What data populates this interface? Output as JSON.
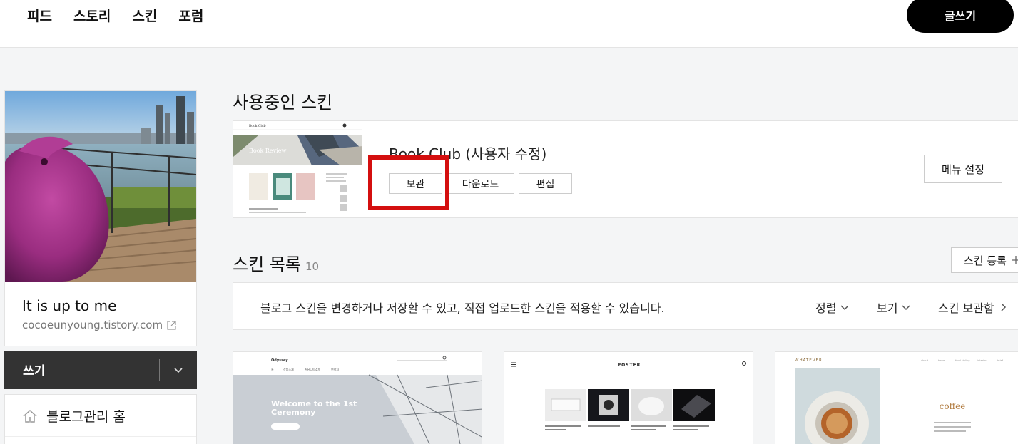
{
  "topnav": {
    "items": [
      "피드",
      "스토리",
      "스킨",
      "포럼"
    ],
    "write_label": "글쓰기"
  },
  "sidebar": {
    "blog_name": "It is up to me",
    "blog_url": "cocoeunyoung.tistory.com",
    "write_label": "쓰기",
    "admin_home_label": "블로그관리 홈"
  },
  "current_skin": {
    "section_title": "사용중인 스킨",
    "name": "Book Club (사용자 수정)",
    "buttons": [
      "보관",
      "다운로드",
      "편집"
    ],
    "menu_settings_label": "메뉴 설정",
    "thumb": {
      "brand": "Book Club",
      "banner": "Book Review"
    }
  },
  "skin_list": {
    "section_title": "스킨 목록",
    "count": "10",
    "register_label": "스킨 등록",
    "info_text": "블로그 스킨을 변경하거나 저장할 수 있고, 직접 업로드한 스킨을 적용할 수 있습니다.",
    "sort_label": "정렬",
    "view_label": "보기",
    "storage_label": "스킨 보관함",
    "cards": [
      {
        "brand": "Odyssey",
        "headline": "Welcome to the 1st Ceremony"
      },
      {
        "brand": "POSTER"
      },
      {
        "brand": "WHATEVER",
        "headline": "coffee"
      }
    ]
  },
  "colors": {
    "highlight": "#d40f0f",
    "write_button_bg": "#000000",
    "write_bar_bg": "#333333",
    "page_bg": "#f4f5f6"
  }
}
